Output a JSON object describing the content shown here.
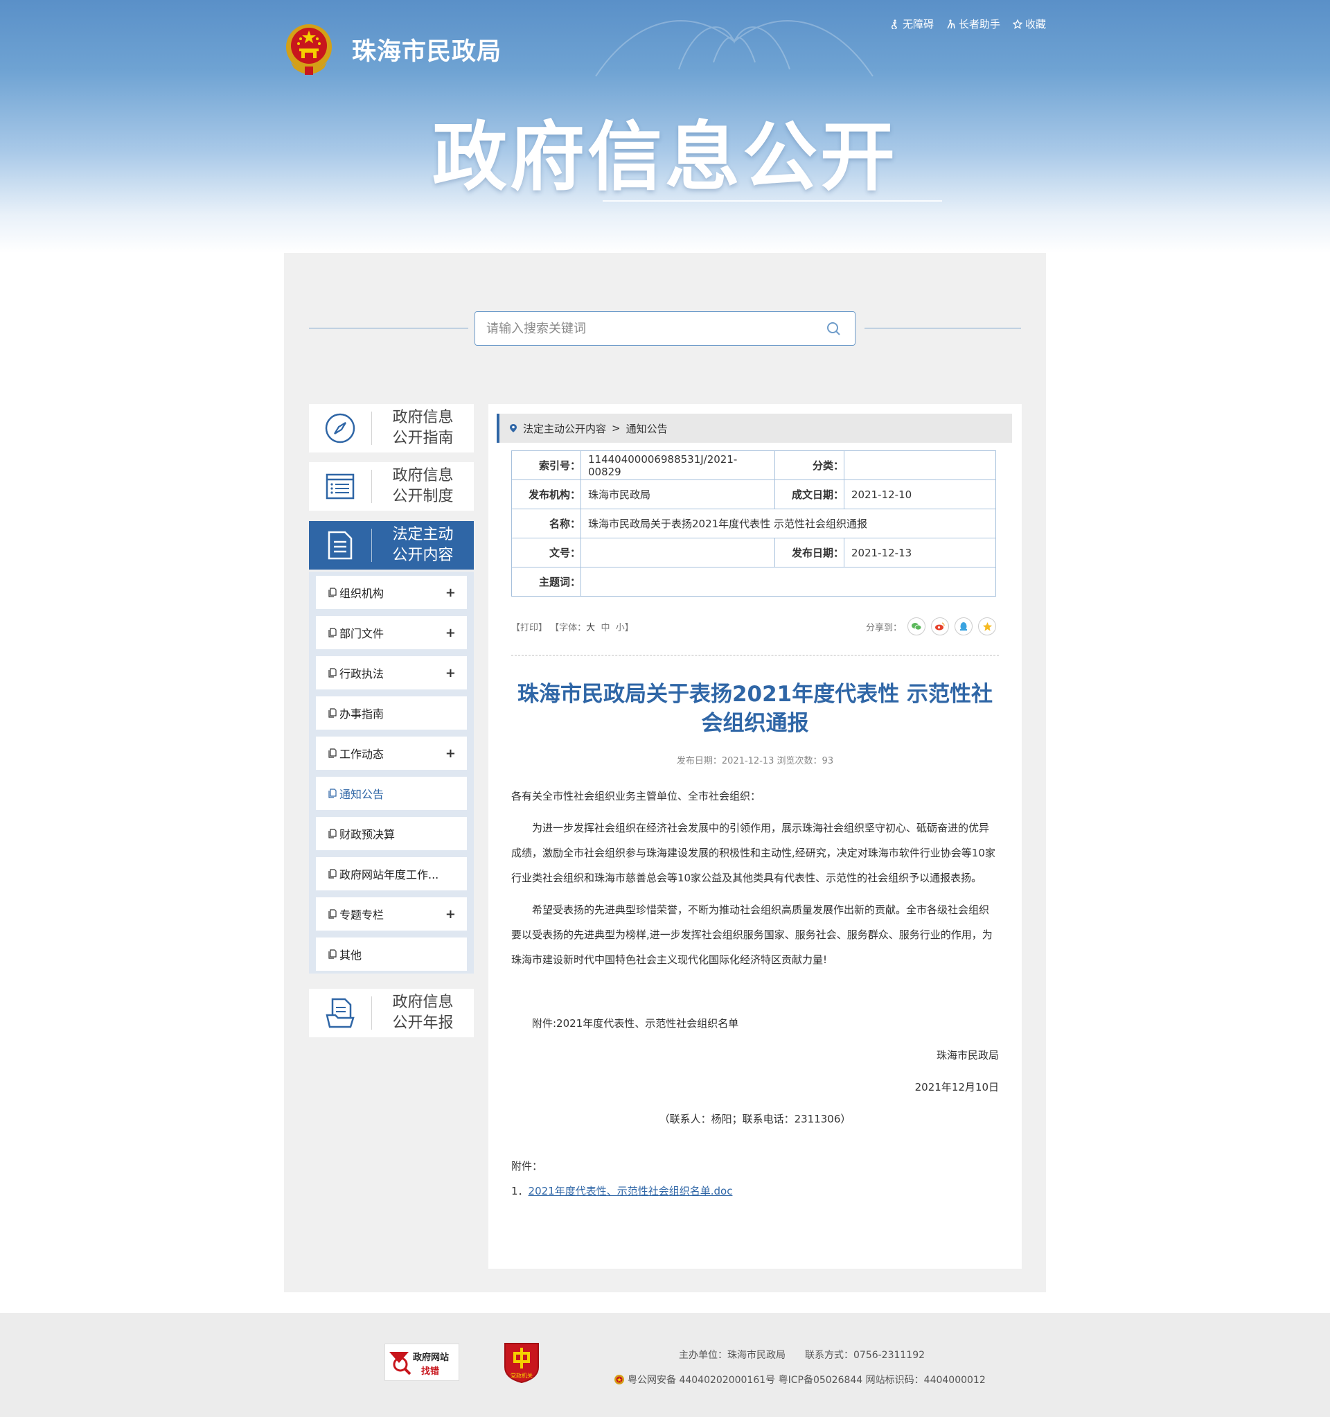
{
  "header": {
    "site_name": "珠海市民政局",
    "banner_title": "政府信息公开",
    "top_links": [
      {
        "label": "无障碍",
        "icon": "accessibility-icon"
      },
      {
        "label": "长者助手",
        "icon": "elderly-helper-icon"
      },
      {
        "label": "收藏",
        "icon": "star-icon"
      }
    ]
  },
  "search": {
    "placeholder": "请输入搜索关键词"
  },
  "sidebar": {
    "blocks": [
      {
        "line1": "政府信息",
        "line2": "公开指南",
        "icon": "compass-icon"
      },
      {
        "line1": "政府信息",
        "line2": "公开制度",
        "icon": "list-icon"
      },
      {
        "line1": "法定主动",
        "line2": "公开内容",
        "icon": "document-icon",
        "active": true
      },
      {
        "line1": "政府信息",
        "line2": "公开年报",
        "icon": "report-icon"
      }
    ],
    "sub_items": [
      {
        "label": "组织机构",
        "expand": "+"
      },
      {
        "label": "部门文件",
        "expand": "+"
      },
      {
        "label": "行政执法",
        "expand": "+"
      },
      {
        "label": "办事指南",
        "expand": ""
      },
      {
        "label": "工作动态",
        "expand": "+"
      },
      {
        "label": "通知公告",
        "expand": ""
      },
      {
        "label": "财政预决算",
        "expand": ""
      },
      {
        "label": "政府网站年度工作...",
        "expand": ""
      },
      {
        "label": "专题专栏",
        "expand": "+"
      },
      {
        "label": "其他",
        "expand": ""
      }
    ]
  },
  "breadcrumb": {
    "items": [
      "法定主动公开内容",
      "通知公告"
    ],
    "separator": ">"
  },
  "meta": {
    "index_label": "索引号：",
    "index_value": "11440400006988531J/2021-00829",
    "category_label": "分类：",
    "category_value": "",
    "publisher_label": "发布机构：",
    "publisher_value": "珠海市民政局",
    "created_label": "成文日期：",
    "created_value": "2021-12-10",
    "name_label": "名称：",
    "name_value": "珠海市民政局关于表扬2021年度代表性 示范性社会组织通报",
    "docno_label": "文号：",
    "docno_value": "",
    "pubdate_label": "发布日期：",
    "pubdate_value": "2021-12-13",
    "subject_label": "主题词：",
    "subject_value": ""
  },
  "tools": {
    "print": "【打印】",
    "font_prefix": "【字体：",
    "font_large": "大",
    "font_medium": "中",
    "font_small": "小",
    "font_suffix": "】",
    "share_label": "分享到："
  },
  "article": {
    "title": "珠海市民政局关于表扬2021年度代表性 示范性社会组织通报",
    "meta": "发布日期：2021-12-13  浏览次数：93",
    "salutation": "各有关全市性社会组织业务主管单位、全市社会组织：",
    "para1": "为进一步发挥社会组织在经济社会发展中的引领作用，展示珠海社会组织坚守初心、砥砺奋进的优异成绩，激励全市社会组织参与珠海建设发展的积极性和主动性,经研究，决定对珠海市软件行业协会等10家行业类社会组织和珠海市慈善总会等10家公益及其他类具有代表性、示范性的社会组织予以通报表扬。",
    "para2": "希望受表扬的先进典型珍惜荣誉，不断为推动社会组织高质量发展作出新的贡献。全市各级社会组织要以受表扬的先进典型为榜样,进一步发挥社会组织服务国家、服务社会、服务群众、服务行业的作用，为珠海市建设新时代中国特色社会主义现代化国际化经济特区贡献力量!",
    "attachment_note": "附件:2021年度代表性、示范性社会组织名单",
    "signature": "珠海市民政局",
    "date": "2021年12月10日",
    "contact": "（联系人：杨阳；联系电话：2311306）"
  },
  "attachments": {
    "label": "附件：",
    "items": [
      {
        "index": "1．",
        "name": "2021年度代表性、示范性社会组织名单.doc"
      }
    ]
  },
  "footer": {
    "badge_gov_line1": "政府网站",
    "badge_gov_line2": "找错",
    "badge_party": "党政机关",
    "sponsor": "主办单位：珠海市民政局　　联系方式：0756-2311192",
    "records": "粤公网安备 44040202000161号 粤ICP备05026844 网站标识码：4404000012"
  },
  "colors": {
    "accent": "#2f66a6",
    "banner": "#5a90c8",
    "panel": "#f0f0f0"
  }
}
